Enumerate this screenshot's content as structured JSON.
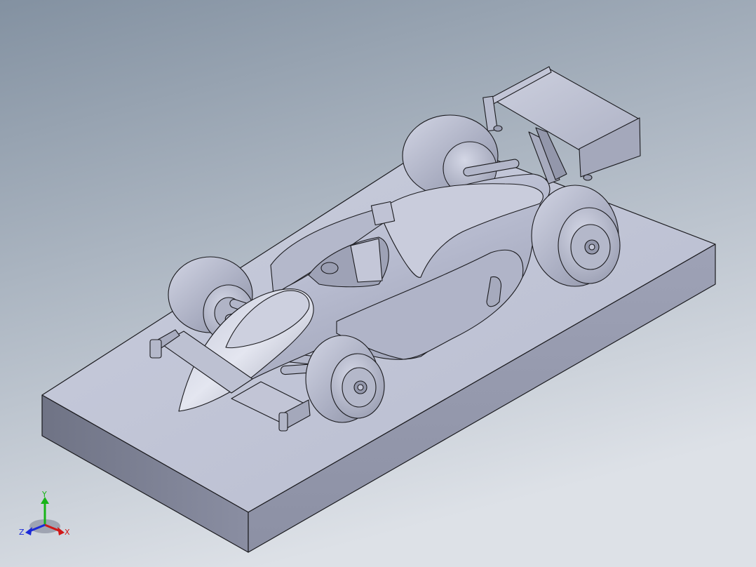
{
  "viewport": {
    "background_top": "#8492a2",
    "background_bottom": "#dadfe6",
    "model_fill": "#bfc3d7",
    "edge_color": "#1b1b1f"
  },
  "triad": {
    "x_label": "X",
    "y_label": "Y",
    "z_label": "Z",
    "x_color": "#d01818",
    "y_color": "#18b418",
    "z_color": "#1c2ad8"
  }
}
